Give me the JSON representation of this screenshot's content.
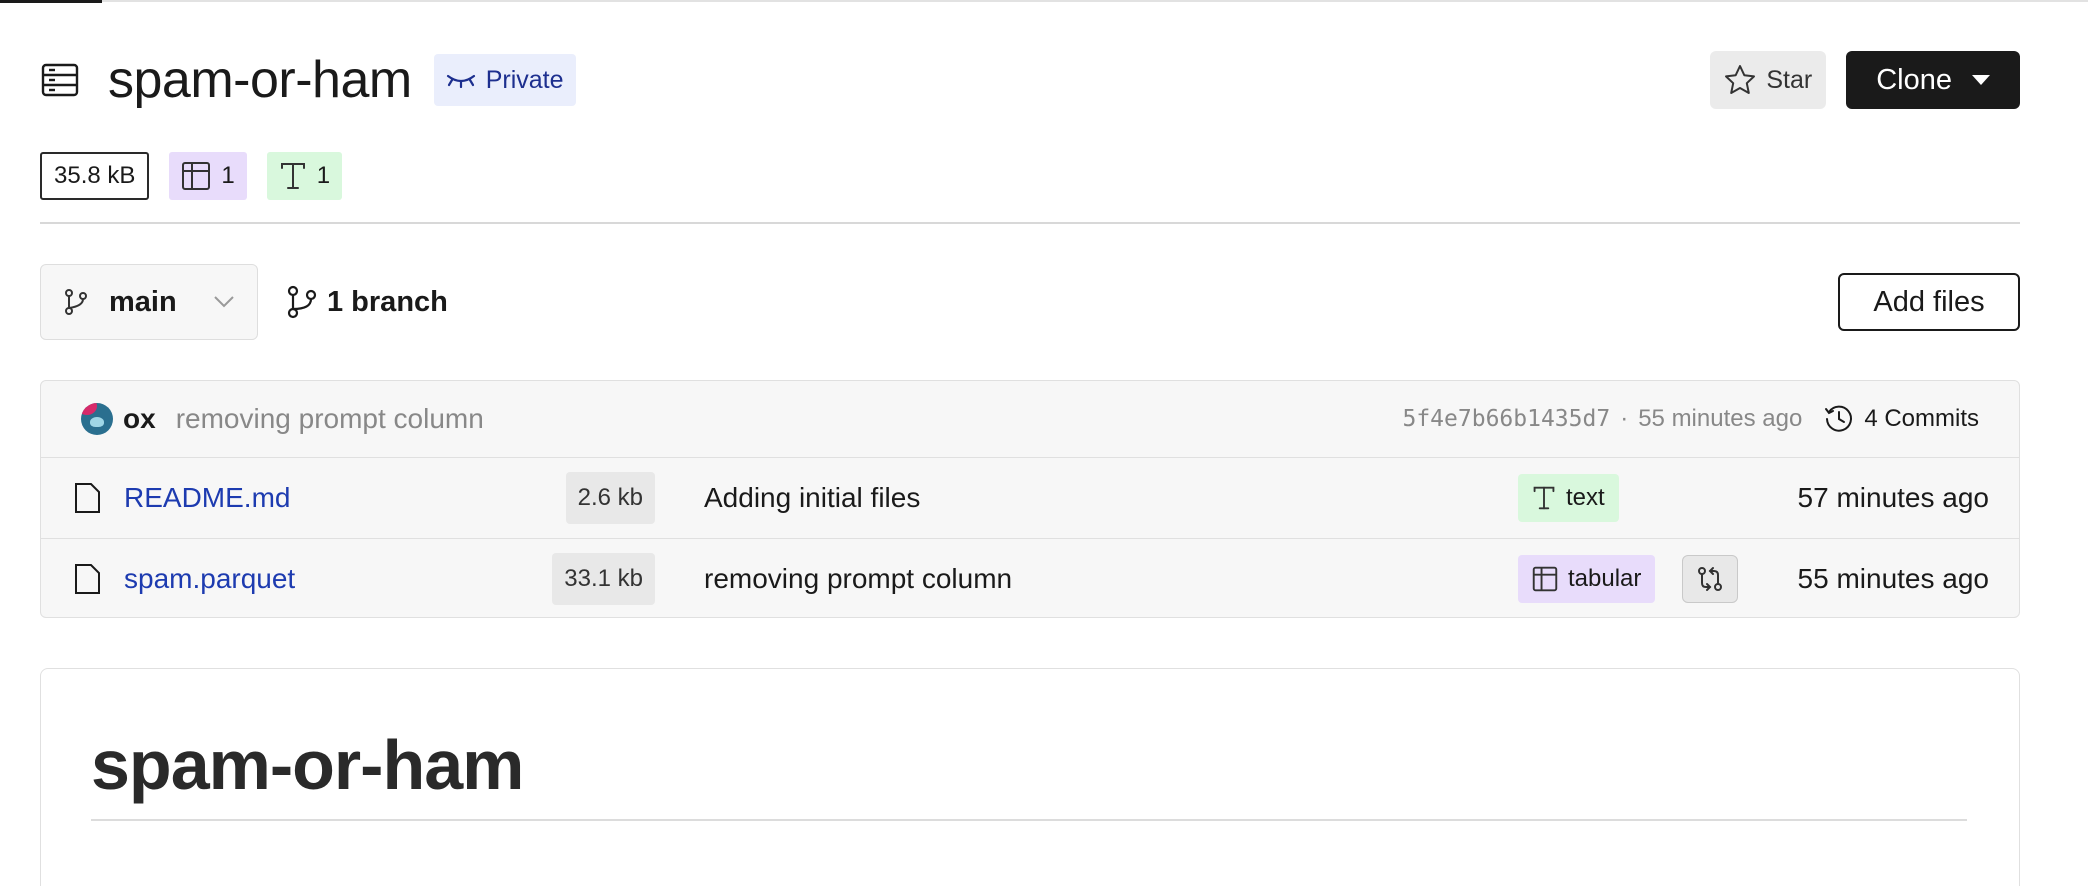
{
  "repo": {
    "title": "spam-or-ham",
    "visibility": "Private",
    "star_label": "Star",
    "clone_label": "Clone"
  },
  "stats": {
    "size": "35.8 kB",
    "tabular_count": "1",
    "text_count": "1"
  },
  "branch": {
    "current": "main",
    "count_label": "1 branch",
    "add_files_label": "Add files"
  },
  "commit": {
    "author": "ox",
    "message": "removing prompt column",
    "hash": "5f4e7b66b1435d7",
    "separator": "·",
    "time": "55 minutes ago",
    "commits_label": "4 Commits"
  },
  "files": [
    {
      "name": "README.md",
      "size": "2.6 kb",
      "message": "Adding initial files",
      "tag": "text",
      "time": "57 minutes ago"
    },
    {
      "name": "spam.parquet",
      "size": "33.1 kb",
      "message": "removing prompt column",
      "tag": "tabular",
      "time": "55 minutes ago"
    }
  ],
  "readme": {
    "heading": "spam-or-ham"
  },
  "colors": {
    "private_badge_bg": "#eaeefc",
    "private_badge_text": "#1d2f8f",
    "clone_bg": "#1a1a1a",
    "tabular_tag_bg": "#e8dcfb",
    "text_tag_bg": "#d9f8dd",
    "file_link": "#1d3bb0"
  },
  "icons": {
    "repo": "dataset-icon",
    "private": "eye-closed-icon",
    "star": "star-icon",
    "tabular": "table-icon",
    "text": "text-t-icon",
    "branch": "git-branch-icon",
    "history": "history-icon",
    "file": "file-icon",
    "diff": "compare-icon"
  }
}
